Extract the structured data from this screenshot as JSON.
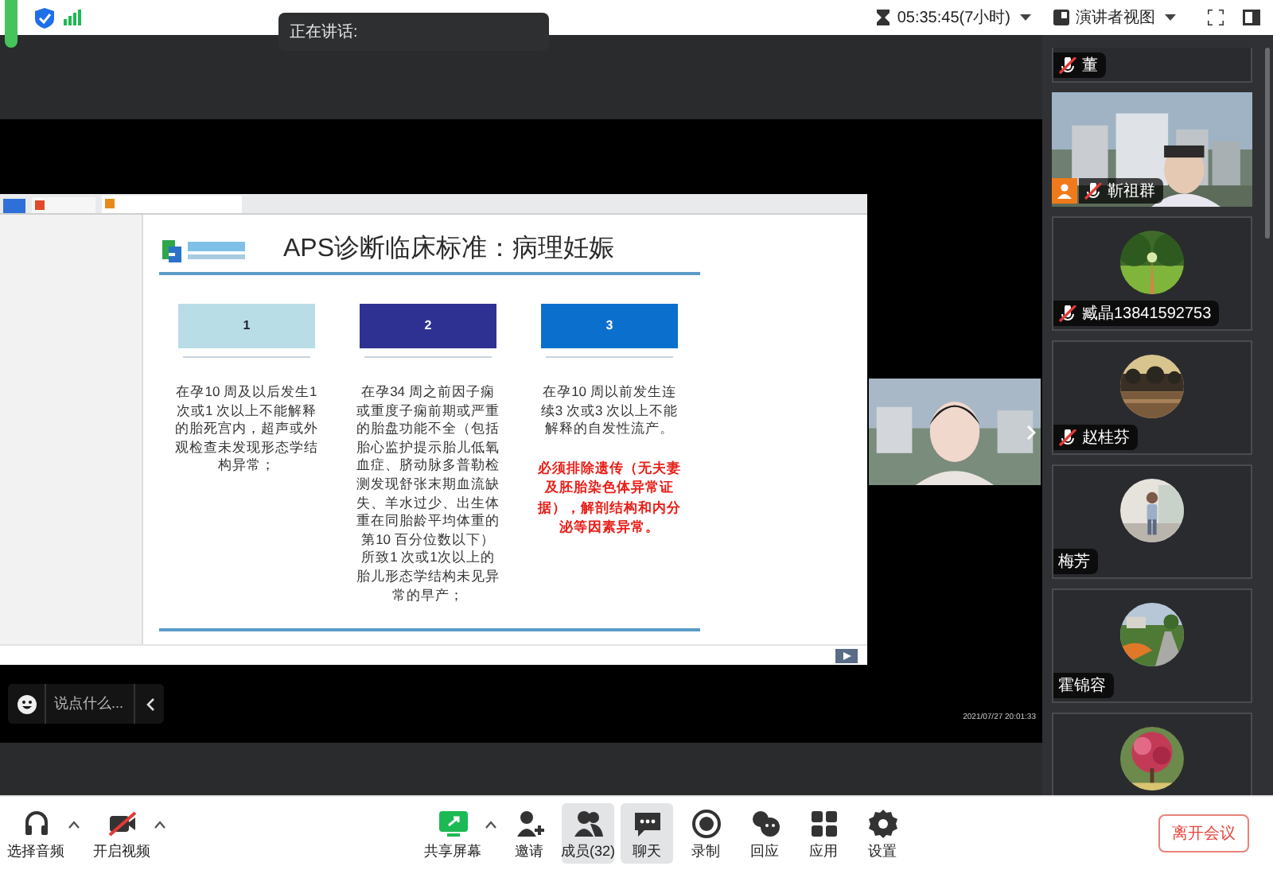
{
  "top_bar": {
    "timer": "05:35:45(7小时)",
    "view": "演讲者视图"
  },
  "speaking_tooltip": {
    "label": "正在讲话:"
  },
  "slide": {
    "title": "APS诊断临床标准：病理妊娠",
    "columns": [
      {
        "number": "1",
        "color": "#b9dde6",
        "text": "在孕10 周及以后发生1 次或1 次以上不能解释的胎死宫内，超声或外观检查未发现形态学结构异常；"
      },
      {
        "number": "2",
        "color": "#2e3192",
        "text": "在孕34 周之前因子痫或重度子痫前期或严重的胎盘功能不全（包括胎心监护提示胎儿低氧血症、脐动脉多普勒检测发现舒张末期血流缺失、羊水过少、出生体重在同胎龄平均体重的第10 百分位数以下）所致1 次或1次以上的胎儿形态学结构未见异常的早产；"
      },
      {
        "number": "3",
        "color": "#0b6fce",
        "text": "在孕10 周以前发生连续3 次或3 次以上不能解释的自发性流产。",
        "note": "必须排除遗传（无夫妻及胚胎染色体异常证据），解剖结构和内分泌等因素异常。"
      }
    ]
  },
  "chat_input": {
    "placeholder": "说点什么..."
  },
  "timestamp": "2021/07/27 20:01:33",
  "participants": [
    {
      "kind": "cut",
      "name": "董",
      "muted": true
    },
    {
      "kind": "video",
      "name": "靳祖群",
      "muted": true
    },
    {
      "kind": "avatar",
      "name": "臧晶13841592753",
      "muted": true
    },
    {
      "kind": "avatar",
      "name": "赵桂芬",
      "muted": true
    },
    {
      "kind": "avatar",
      "name": "梅芳",
      "muted": false
    },
    {
      "kind": "avatar",
      "name": "霍锦容",
      "muted": false
    },
    {
      "kind": "avatar"
    }
  ],
  "toolbar": [
    {
      "kind": "audio",
      "label": "选择音频",
      "menu": true,
      "selected": false
    },
    {
      "kind": "video",
      "label": "开启视频",
      "menu": true,
      "selected": false
    },
    {
      "kind": "share",
      "label": "共享屏幕",
      "menu": true,
      "selected": false
    },
    {
      "kind": "invite",
      "label": "邀请",
      "menu": false,
      "selected": false
    },
    {
      "kind": "members",
      "label": "成员(32)",
      "menu": false,
      "selected": true
    },
    {
      "kind": "chat",
      "label": "聊天",
      "menu": false,
      "selected": true
    },
    {
      "kind": "record",
      "label": "录制",
      "menu": false,
      "selected": false
    },
    {
      "kind": "react",
      "label": "回应",
      "menu": false,
      "selected": false
    },
    {
      "kind": "apps",
      "label": "应用",
      "menu": false,
      "selected": false
    },
    {
      "kind": "settings",
      "label": "设置",
      "menu": false,
      "selected": false
    }
  ],
  "leave_button": "离开会议"
}
